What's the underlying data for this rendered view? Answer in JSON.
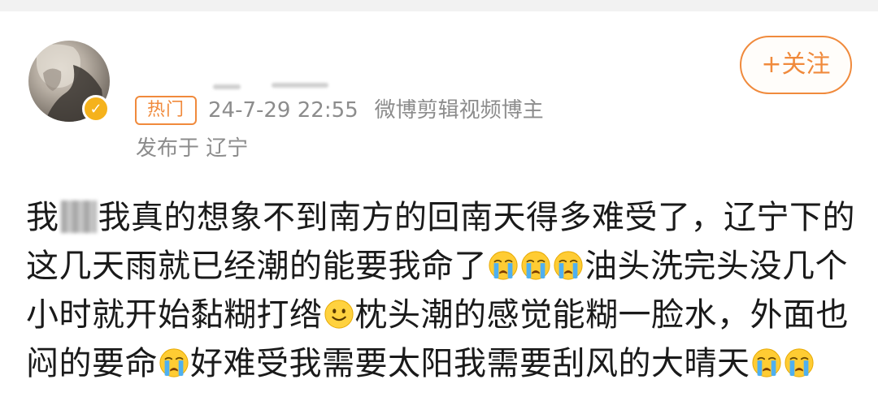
{
  "post": {
    "hot_tag": "热门",
    "timestamp": "24-7-29 22:55",
    "author_title": "微博剪辑视频博主",
    "location": "发布于 辽宁",
    "follow_label": "+关注",
    "body": {
      "line1_a": "我",
      "line1_b": "我真的想象不到南方的回南天得多难受了，辽宁下的",
      "line2_a": "这几天雨就已经潮的能要我命了",
      "line2_b": "油头洗完头没几个",
      "line3_a": "小时就开始黏糊打绺",
      "line3_b": "枕头潮的感觉能糊一脸水，外面也",
      "line4_a": "闷的要命",
      "line4_b": "好难受我需要太阳我需要刮风的大晴天"
    }
  },
  "icons": {
    "crying": "loudly-crying-face-icon",
    "smile": "slightly-smiling-face-icon",
    "verified": "verified-badge-icon"
  },
  "colors": {
    "accent": "#f08a3c",
    "meta_text": "#8c8c8c",
    "badge": "#f5b21c"
  }
}
